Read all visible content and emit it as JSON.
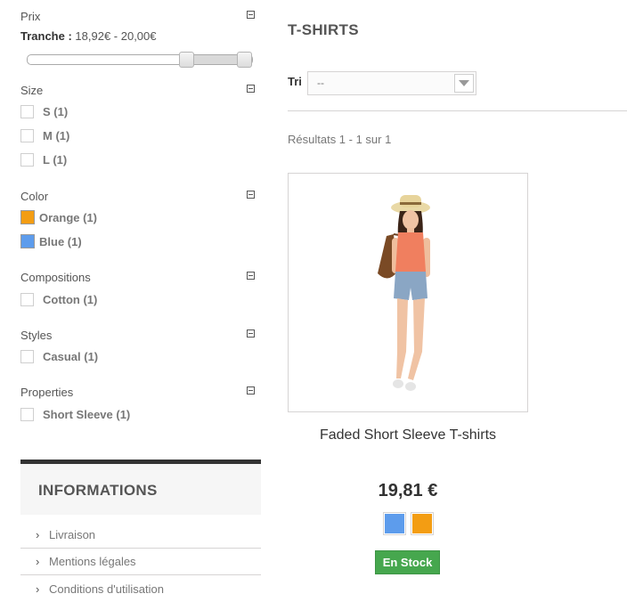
{
  "filters": {
    "price": {
      "title": "Prix",
      "range_label": "Tranche :",
      "range_value": "18,92€ - 20,00€",
      "slider_low_fraction": 0.72,
      "slider_high_fraction": 1.0
    },
    "size": {
      "title": "Size",
      "options": [
        "S (1)",
        "M (1)",
        "L (1)"
      ]
    },
    "color": {
      "title": "Color",
      "options": [
        {
          "label": "Orange (1)",
          "swatch": "#f39d13"
        },
        {
          "label": "Blue (1)",
          "swatch": "#5d9cec"
        }
      ]
    },
    "compositions": {
      "title": "Compositions",
      "options": [
        "Cotton (1)"
      ]
    },
    "styles": {
      "title": "Styles",
      "options": [
        "Casual (1)"
      ]
    },
    "properties": {
      "title": "Properties",
      "options": [
        "Short Sleeve (1)"
      ]
    }
  },
  "informations": {
    "title": "INFORMATIONS",
    "links": [
      "Livraison",
      "Mentions légales",
      "Conditions d'utilisation"
    ]
  },
  "category": {
    "heading": "T-SHIRTS",
    "sort_label": "Tri",
    "sort_value": "--",
    "results": "Résultats 1 - 1 sur 1"
  },
  "product": {
    "name": "Faded Short Sleeve T-shirts",
    "price": "19,81 €",
    "colors": [
      "#5d9cec",
      "#f39d13"
    ],
    "stock_label": "En Stock",
    "image": "photo of model in straw hat, coral top and denim shorts"
  }
}
